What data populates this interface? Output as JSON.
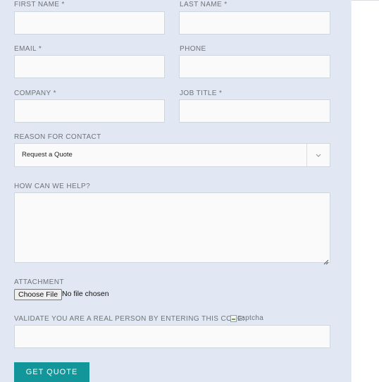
{
  "form": {
    "first_name_label": "FIRST NAME *",
    "last_name_label": "LAST NAME *",
    "email_label": "EMAIL *",
    "phone_label": "PHONE",
    "company_label": "COMPANY *",
    "job_title_label": "JOB TITLE *",
    "reason_label": "REASON FOR CONTACT",
    "reason_selected": "Request a Quote",
    "help_label": "HOW CAN WE HELP?",
    "attachment_label": "ATTACHMENT",
    "file_button": "Choose File",
    "file_status": "No file chosen",
    "captcha_label": "VALIDATE YOU ARE A REAL PERSON BY ENTERING THIS CODE:",
    "captcha_alt": "captcha",
    "submit_label": "GET QUOTE"
  },
  "colors": {
    "panel_bg": "#e1e8f3",
    "field_bg": "#fafafa",
    "field_border": "#cfd6de",
    "label_text": "#6f7378",
    "button_bg": "#13969a",
    "button_text": "#ffffff"
  },
  "icons": {
    "select_arrow": "chevron-down-icon",
    "textarea_resize": "resize-grip-icon",
    "captcha_image": "broken-image-icon"
  }
}
